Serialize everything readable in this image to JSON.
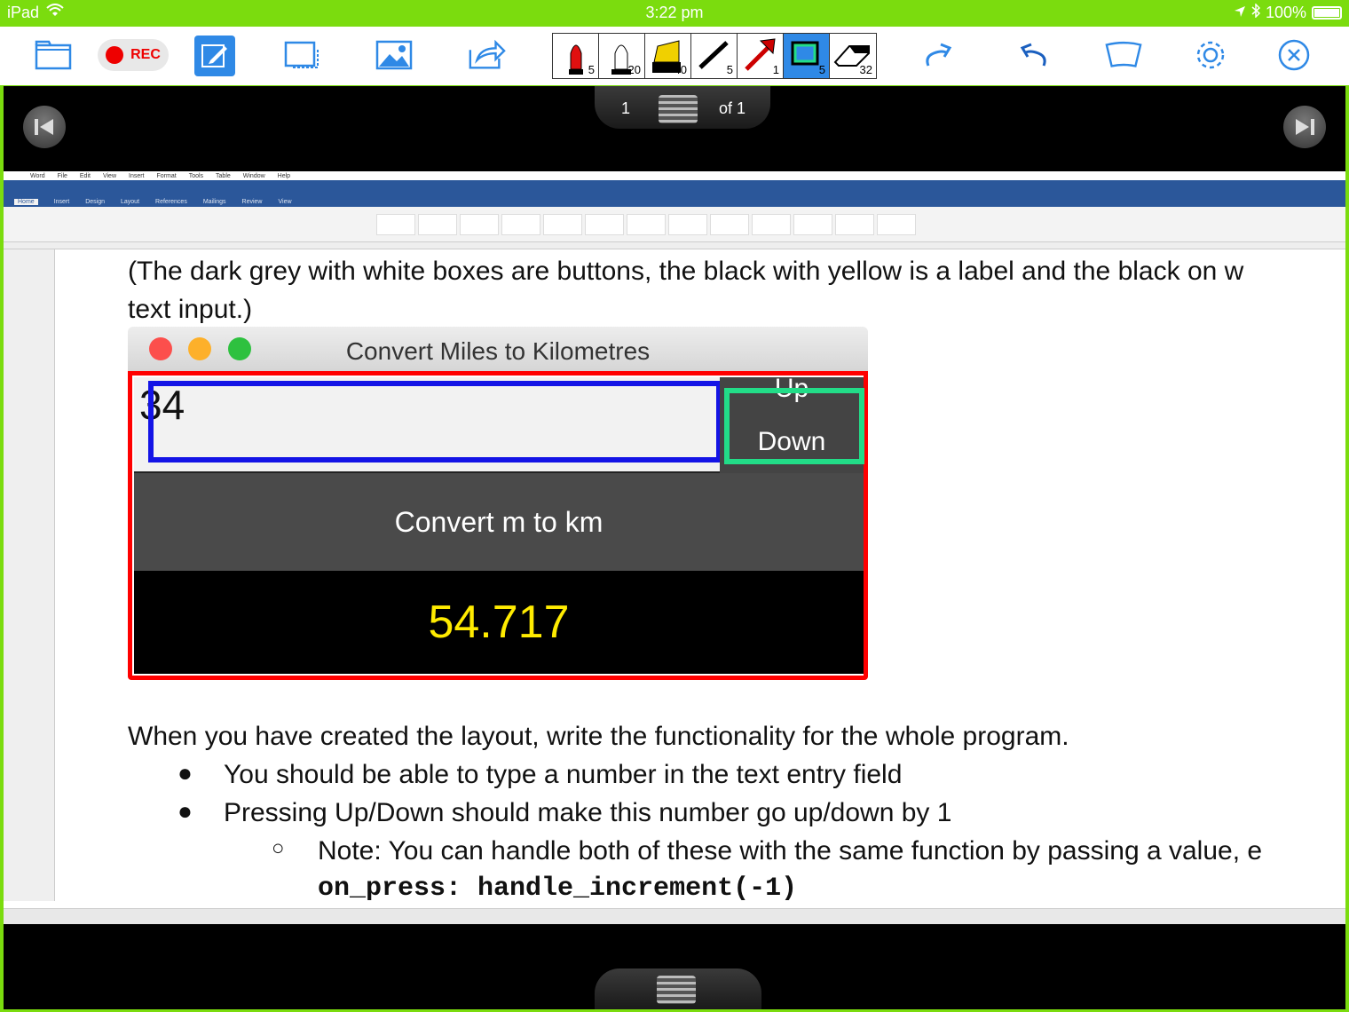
{
  "status_bar": {
    "device": "iPad",
    "time": "3:22 pm",
    "battery": "100%"
  },
  "toolbar": {
    "rec_label": "REC",
    "tool_sizes": [
      "5",
      "20",
      "40",
      "5",
      "1",
      "5",
      "32"
    ],
    "accent_color": "#2f89e6",
    "frame_color": "#7bdc0e"
  },
  "pager": {
    "current_page": "1",
    "total_label": "of 1"
  },
  "document": {
    "intro_line_1": "(The dark grey with white boxes are buttons, the black with yellow is a label and the black on w",
    "intro_line_2": "text input.)",
    "body_line": "When you have created the layout, write the functionality for the whole program.",
    "bullets": [
      "You should be able to type a number in the text entry field",
      "Pressing Up/Down should make this number go up/down by 1"
    ],
    "sub_bullet": "Note: You can handle both of these with the same function by passing a value, e",
    "code_line": "on_press: handle_increment(-1)"
  },
  "app_window": {
    "title": "Convert Miles to Kilometres",
    "entry_value": "34",
    "up_label": "Up",
    "down_label": "Down",
    "convert_label": "Convert m to km",
    "result_value": "54.717"
  }
}
